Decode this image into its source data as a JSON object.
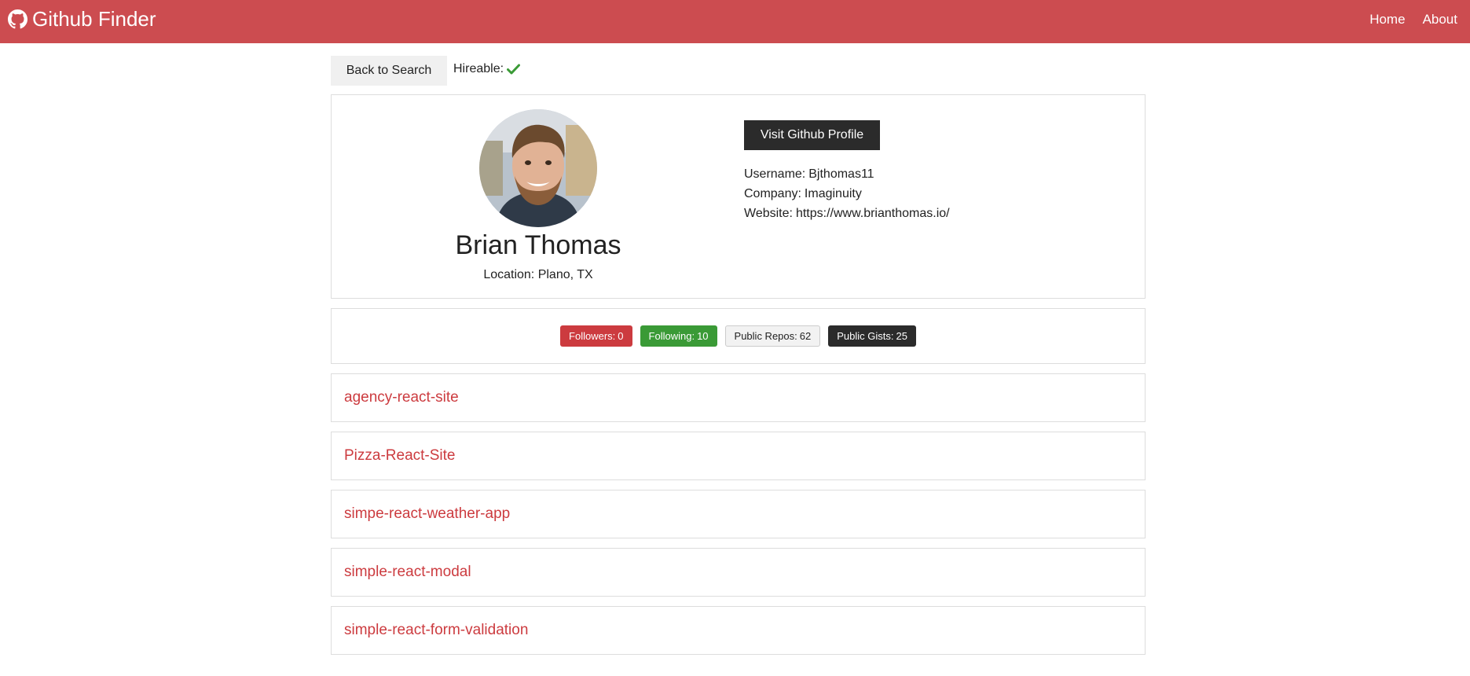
{
  "navbar": {
    "brand_icon": "github-icon",
    "brand_title": "Github Finder",
    "links": {
      "home": "Home",
      "about": "About"
    },
    "background": "#cc4c50"
  },
  "actions": {
    "back_label": "Back to Search",
    "hireable_label": "Hireable:",
    "hireable_icon": "check-icon",
    "hireable_color": "#3a9a36"
  },
  "profile": {
    "avatar_icon": "profile-photo",
    "name": "Brian Thomas",
    "location_label": "Location:",
    "location": "Plano, TX",
    "visit_label": "Visit Github Profile",
    "username_label": "Username:",
    "username": "Bjthomas11",
    "company_label": "Company:",
    "company": "Imaginuity",
    "website_label": "Website:",
    "website": "https://www.brianthomas.io/"
  },
  "stats": {
    "followers_label": "Followers:",
    "followers": "0",
    "following_label": "Following:",
    "following": "10",
    "repos_label": "Public Repos:",
    "repos": "62",
    "gists_label": "Public Gists:",
    "gists": "25"
  },
  "repos": [
    {
      "name": "agency-react-site"
    },
    {
      "name": "Pizza-React-Site"
    },
    {
      "name": "simpe-react-weather-app"
    },
    {
      "name": "simple-react-modal"
    },
    {
      "name": "simple-react-form-validation"
    }
  ],
  "colors": {
    "accent_red": "#cc3b3f",
    "success_green": "#3a9a36",
    "dark": "#2b2b2b"
  }
}
